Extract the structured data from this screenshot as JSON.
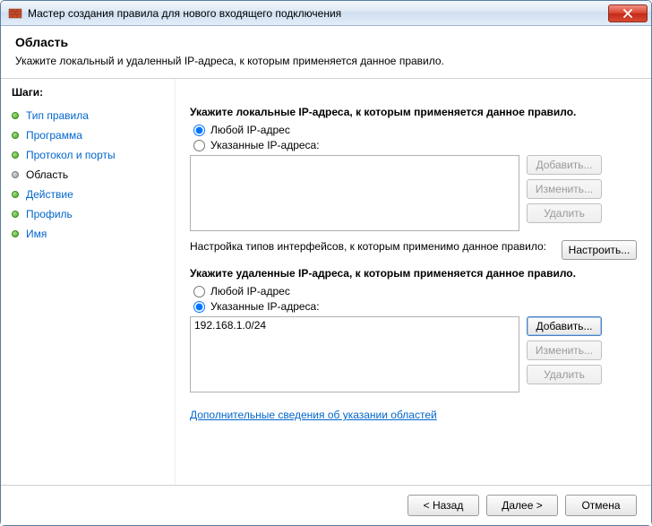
{
  "window": {
    "title": "Мастер создания правила для нового входящего подключения"
  },
  "header": {
    "title": "Область",
    "subtitle": "Укажите локальный и удаленный IP-адреса, к которым применяется данное правило."
  },
  "sidebar": {
    "steps_label": "Шаги:",
    "items": [
      {
        "label": "Тип правила",
        "current": false
      },
      {
        "label": "Программа",
        "current": false
      },
      {
        "label": "Протокол и порты",
        "current": false
      },
      {
        "label": "Область",
        "current": true
      },
      {
        "label": "Действие",
        "current": false
      },
      {
        "label": "Профиль",
        "current": false
      },
      {
        "label": "Имя",
        "current": false
      }
    ]
  },
  "local": {
    "title": "Укажите локальные IP-адреса, к которым применяется данное правило.",
    "any_label": "Любой IP-адрес",
    "specific_label": "Указанные IP-адреса:",
    "selected": "any",
    "addresses": [],
    "buttons": {
      "add": "Добавить...",
      "edit": "Изменить...",
      "remove": "Удалить"
    }
  },
  "interfaces": {
    "text": "Настройка типов интерфейсов, к которым применимо данное правило:",
    "button": "Настроить..."
  },
  "remote": {
    "title": "Укажите удаленные IP-адреса, к которым применяется данное правило.",
    "any_label": "Любой IP-адрес",
    "specific_label": "Указанные IP-адреса:",
    "selected": "specific",
    "addresses": [
      "192.168.1.0/24"
    ],
    "buttons": {
      "add": "Добавить...",
      "edit": "Изменить...",
      "remove": "Удалить"
    }
  },
  "help_link": "Дополнительные сведения об указании областей",
  "footer": {
    "back": "< Назад",
    "next": "Далее >",
    "cancel": "Отмена"
  }
}
